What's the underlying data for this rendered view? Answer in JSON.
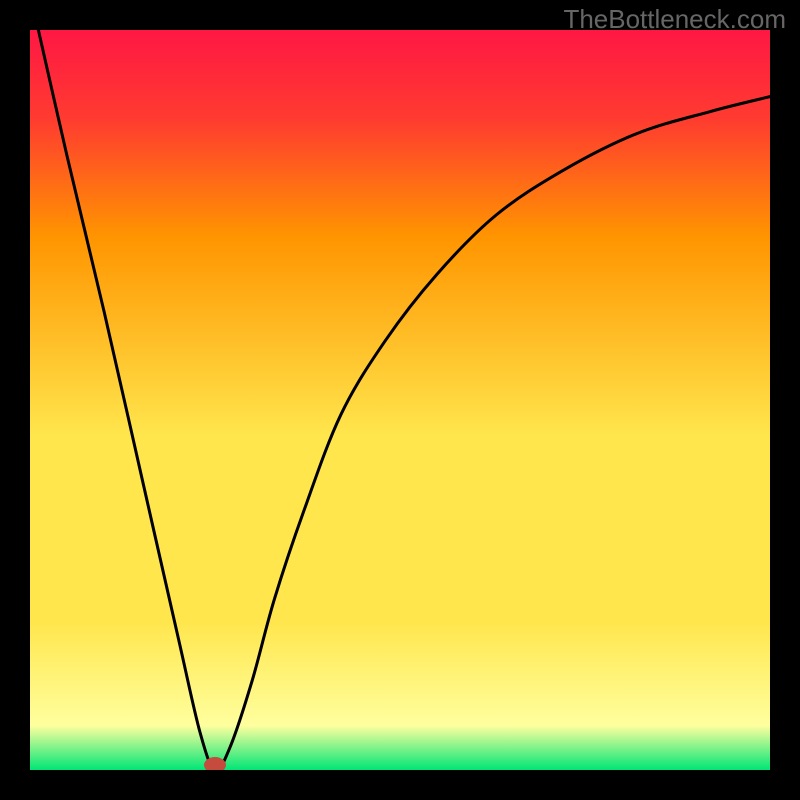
{
  "watermark": "TheBottleneck.com",
  "colors": {
    "black": "#000000",
    "top_red": "#ff1744",
    "mid_red": "#ff3b30",
    "orange": "#ff9500",
    "yellow": "#ffe64d",
    "pale_yellow": "#ffff9e",
    "green": "#00e676",
    "curve": "#000000",
    "marker": "#c44b3e"
  },
  "chart_data": {
    "type": "line",
    "title": "",
    "xlabel": "",
    "ylabel": "",
    "xlim": [
      0,
      100
    ],
    "ylim": [
      0,
      100
    ],
    "grid": false,
    "series": [
      {
        "name": "bottleneck-curve",
        "x": [
          0,
          5,
          10,
          15,
          20,
          23,
          25,
          27,
          30,
          33,
          37,
          42,
          48,
          55,
          63,
          72,
          82,
          92,
          100
        ],
        "y": [
          105,
          83,
          62,
          40,
          18,
          5,
          0,
          3,
          12,
          23,
          35,
          48,
          58,
          67,
          75,
          81,
          86,
          89,
          91
        ]
      }
    ],
    "marker": {
      "x": 25,
      "y": 0
    },
    "gradient_bands": [
      {
        "color_key": "top_red",
        "from": 100,
        "to": 88
      },
      {
        "color_key": "mid_red",
        "from": 88,
        "to": 72
      },
      {
        "color_key": "orange",
        "from": 72,
        "to": 45
      },
      {
        "color_key": "yellow",
        "from": 45,
        "to": 20
      },
      {
        "color_key": "pale_yellow",
        "from": 20,
        "to": 6
      },
      {
        "color_key": "green",
        "from": 6,
        "to": 0
      }
    ]
  }
}
